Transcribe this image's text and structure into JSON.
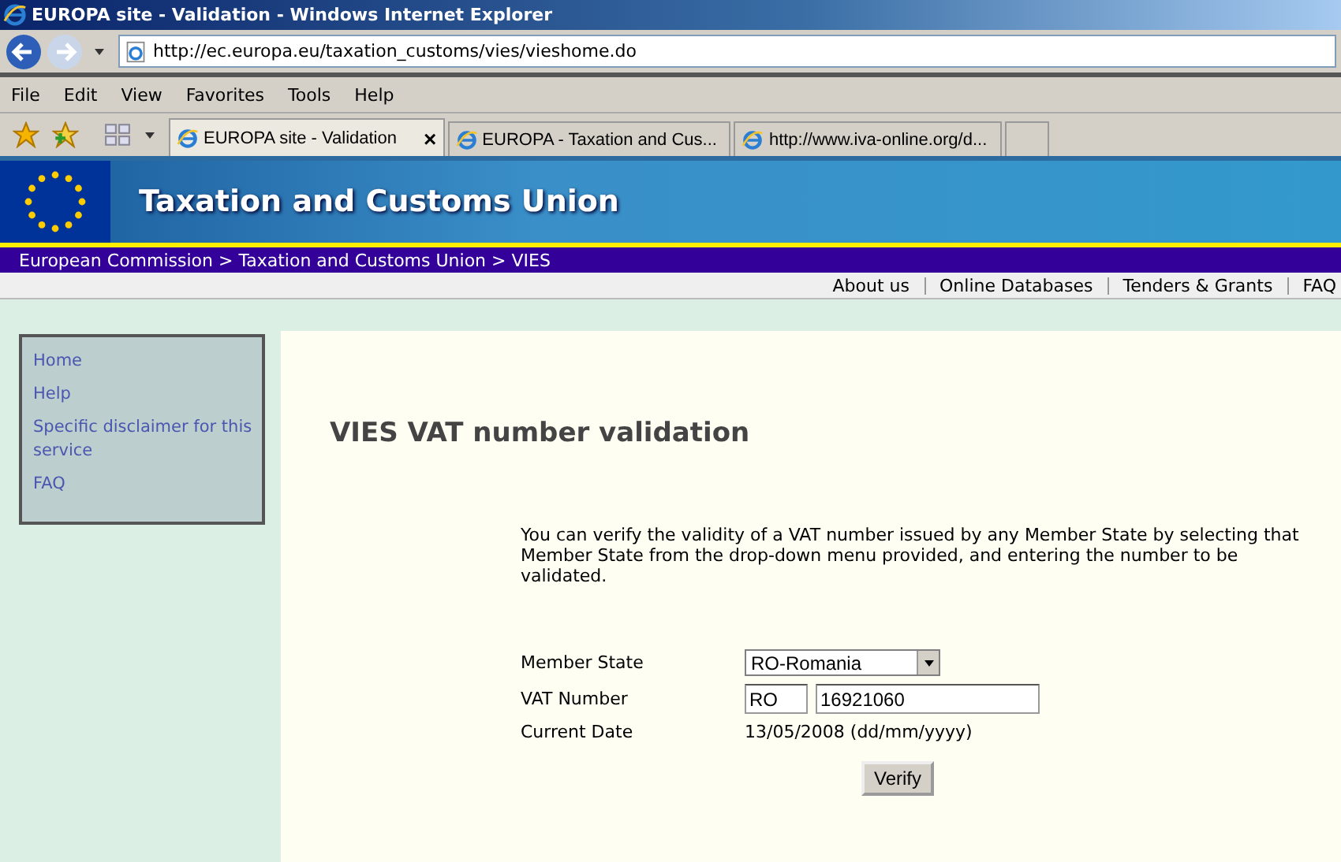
{
  "window": {
    "title": "EUROPA site - Validation - Windows Internet Explorer"
  },
  "address_bar": {
    "url": "http://ec.europa.eu/taxation_customs/vies/vieshome.do"
  },
  "menu": [
    "File",
    "Edit",
    "View",
    "Favorites",
    "Tools",
    "Help"
  ],
  "tabs": [
    {
      "label": "EUROPA site - Validation",
      "selected": true,
      "close": "×"
    },
    {
      "label": "EUROPA - Taxation and Cus...",
      "selected": false
    },
    {
      "label": "http://www.iva-online.org/d...",
      "selected": false
    }
  ],
  "banner": {
    "title": "Taxation and Customs Union"
  },
  "breadcrumb": "European Commission > Taxation and Customs Union > VIES",
  "top_links": [
    "About us",
    "Online Databases",
    "Tenders & Grants",
    "FAQ"
  ],
  "sidebar": {
    "items": [
      "Home",
      "Help",
      "Specific disclaimer for this service",
      "FAQ"
    ]
  },
  "main": {
    "heading": "VIES VAT number validation",
    "intro": "You can verify the validity of a VAT number issued by any Member State by selecting that Member State from the drop-down menu provided, and entering the number to be validated.",
    "form": [
      {
        "kind": "select",
        "label": "Member State",
        "value": "RO-Romania"
      },
      {
        "kind": "vat",
        "label": "VAT Number",
        "prefix": "RO",
        "value": "16921060"
      },
      {
        "kind": "text",
        "label": "Current Date",
        "value": "13/05/2008 (dd/mm/yyyy)"
      }
    ],
    "button": "Verify"
  }
}
